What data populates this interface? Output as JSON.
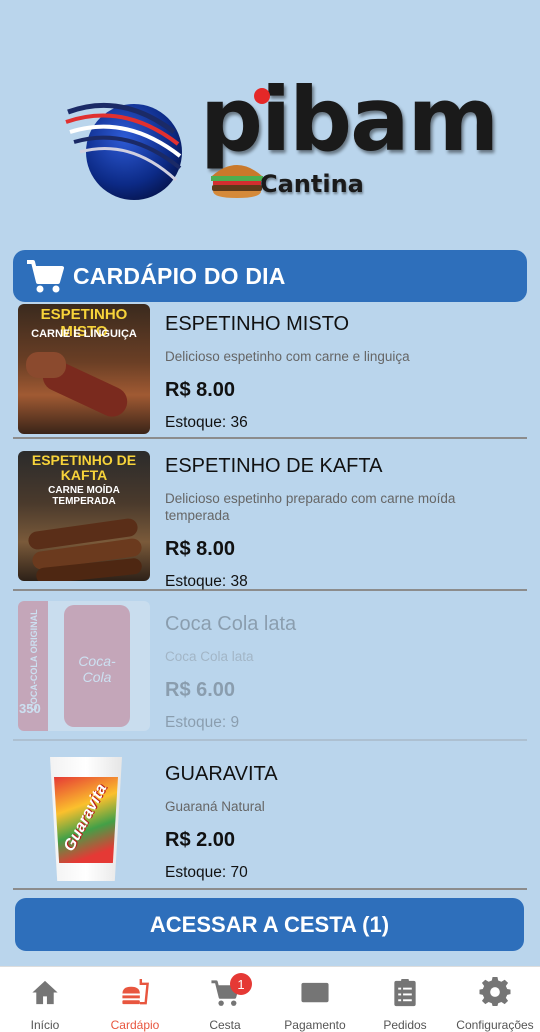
{
  "logo": {
    "word": "pibam",
    "sub": "Cantina"
  },
  "header": {
    "title": "CARDÁPIO DO DIA",
    "icon": "shopping-cart-icon"
  },
  "items": [
    {
      "name": "ESPETINHO MISTO",
      "description": "Delicioso espetinho com carne e linguiça",
      "price": "R$ 8.00",
      "stock": "Estoque: 36",
      "image_text_1": "ESPETINHO MISTO",
      "image_text_2": "CARNE E LINGUIÇA",
      "available": true
    },
    {
      "name": "ESPETINHO DE KAFTA",
      "description": "Delicioso espetinho preparado com carne moída temperada",
      "price": "R$ 8.00",
      "stock": "Estoque: 38",
      "image_text_1": "ESPETINHO DE KAFTA",
      "image_text_2": "CARNE MOÍDA TEMPERADA",
      "available": true
    },
    {
      "name": "Coca Cola lata",
      "description": "Coca Cola lata",
      "price": "R$ 6.00",
      "stock": "Estoque: 9",
      "image_text_1": "COCA-COLA ORIGINAL",
      "image_text_2": "350",
      "image_text_3": "Coca-Cola",
      "available": false
    },
    {
      "name": "GUARAVITA",
      "description": "Guaraná Natural",
      "price": "R$ 2.00",
      "stock": "Estoque: 70",
      "image_text_1": "Guaravita",
      "available": true
    }
  ],
  "basket_button": "ACESSAR A CESTA (1)",
  "nav": [
    {
      "label": "Início",
      "icon": "home-icon"
    },
    {
      "label": "Cardápio",
      "icon": "fastfood-icon",
      "active": true
    },
    {
      "label": "Cesta",
      "icon": "cart-icon",
      "badge": "1"
    },
    {
      "label": "Pagamento",
      "icon": "payment-icon"
    },
    {
      "label": "Pedidos",
      "icon": "clipboard-list-icon"
    },
    {
      "label": "Configurações",
      "icon": "gear-icon"
    }
  ],
  "colors": {
    "background": "#bad5ec",
    "primary": "#2e6fbb",
    "active_nav": "#e8563f",
    "badge": "#e53935"
  }
}
